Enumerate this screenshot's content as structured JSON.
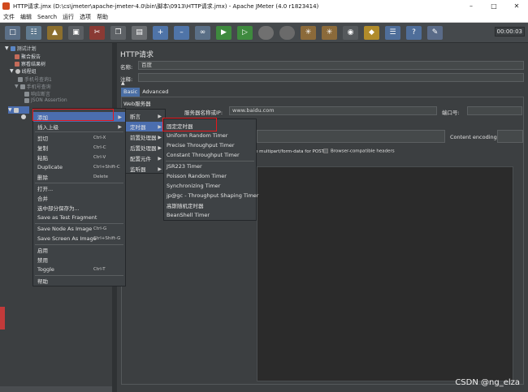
{
  "window": {
    "title": "HTTP请求.jmx (D:\\cs\\jmeter\\apache-jmeter-4.0\\bin\\脚本\\0913\\HTTP请求.jmx) - Apache JMeter (4.0 r1823414)"
  },
  "menubar": [
    "文件",
    "编辑",
    "Search",
    "运行",
    "选项",
    "帮助"
  ],
  "toolbar": {
    "timer": "00:00:03"
  },
  "tree": {
    "n1": "测试计划",
    "n2": "聚合报告",
    "n3": "察看结果树",
    "n4": "线程组",
    "n5": "手机号查询1",
    "n6": "手机号查询",
    "n7": "响应断言",
    "n8": "JSON Assertion"
  },
  "panel": {
    "title": "HTTP请求",
    "name_label": "名称:",
    "name_value": "百度",
    "comment_label": "注释:",
    "tab_basic": "Basic",
    "tab_advanced": "Advanced",
    "web_server": "Web服务器",
    "server_label": "服务器名称或IP:",
    "server_value": "www.baidu.com",
    "port_label": "端口号:",
    "content_encoding_label": "Content encoding:",
    "multipart_label": "e multipart/form-data for POST",
    "browser_headers_label": "Browser-compatible headers"
  },
  "context_menu": {
    "items": [
      {
        "label": "添加",
        "key": ""
      },
      {
        "label": "插入上级",
        "key": ""
      },
      {
        "label": "剪切",
        "key": "Ctrl-X"
      },
      {
        "label": "复制",
        "key": "Ctrl-C"
      },
      {
        "label": "粘贴",
        "key": "Ctrl-V"
      },
      {
        "label": "Duplicate",
        "key": "Ctrl+Shift-C"
      },
      {
        "label": "删除",
        "key": "Delete"
      },
      {
        "label": "打开...",
        "key": ""
      },
      {
        "label": "合并",
        "key": ""
      },
      {
        "label": "选中部分保存为...",
        "key": ""
      },
      {
        "label": "Save as Test Fragment",
        "key": ""
      },
      {
        "label": "Save Node As Image",
        "key": "Ctrl-G"
      },
      {
        "label": "Save Screen As Image",
        "key": "Ctrl+Shift-G"
      },
      {
        "label": "启用",
        "key": ""
      },
      {
        "label": "禁用",
        "key": ""
      },
      {
        "label": "Toggle",
        "key": "Ctrl-T"
      },
      {
        "label": "帮助",
        "key": ""
      }
    ]
  },
  "submenu_add": [
    "断言",
    "定时器",
    "前置处理器",
    "后置处理器",
    "配置元件",
    "监听器"
  ],
  "submenu_timer": [
    "固定定时器",
    "Uniform Random Timer",
    "Precise Throughput Timer",
    "Constant Throughput Timer",
    "JSR223 Timer",
    "Poisson Random Timer",
    "Synchronizing Timer",
    "jp@gc - Throughput Shaping Timer",
    "高斯随机定时器",
    "BeanShell Timer"
  ],
  "watermark": "CSDN @ng_elza",
  "colors": {
    "selection": "#4b6eaf",
    "highlight_box": "#e8171c",
    "background": "#3c3f41"
  }
}
